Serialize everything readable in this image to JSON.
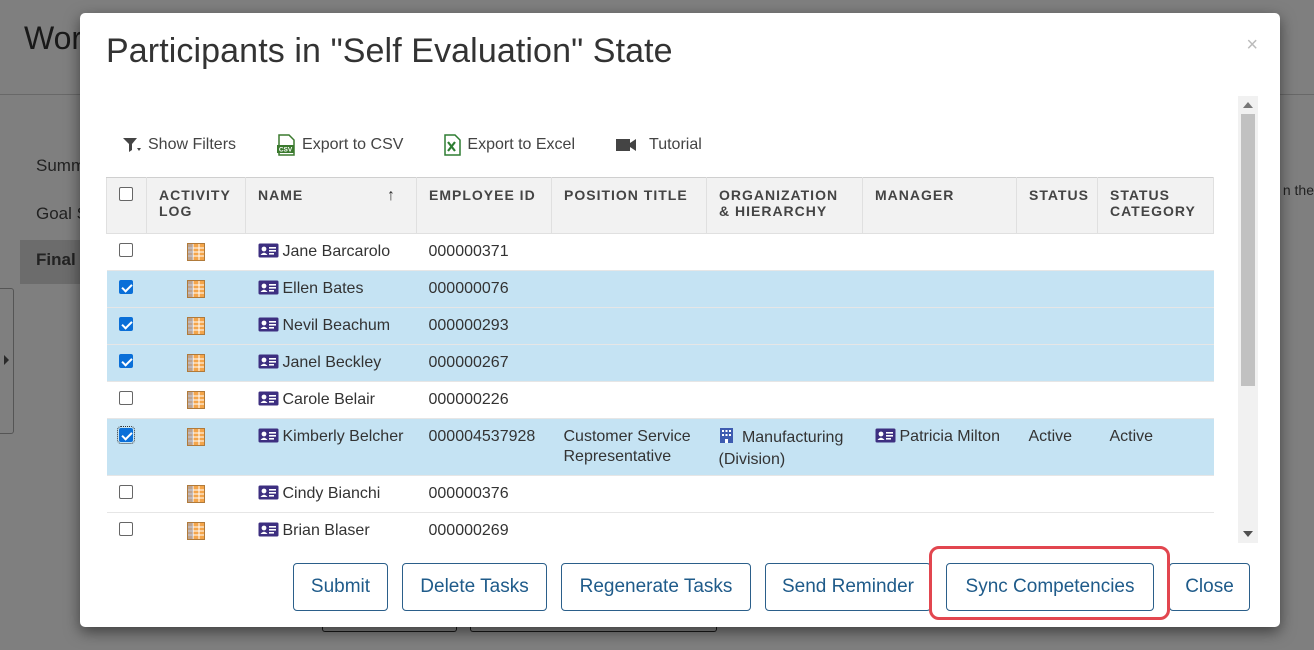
{
  "background": {
    "title": "Wor",
    "nav": [
      "Summ",
      "Goal S",
      "Final"
    ],
    "edge_text": "n the"
  },
  "modal": {
    "title": "Participants in \"Self Evaluation\" State",
    "close_glyph": "×"
  },
  "toolbar": {
    "show_filters": "Show Filters",
    "export_csv": "Export to CSV",
    "export_excel": "Export to Excel",
    "tutorial": "Tutorial"
  },
  "grid": {
    "columns": {
      "activity_log": "ACTIVITY LOG",
      "name": "NAME",
      "employee_id": "EMPLOYEE ID",
      "position_title": "POSITION TITLE",
      "organization": "ORGANIZATION & HIERARCHY",
      "manager": "MANAGER",
      "status": "STATUS",
      "status_category": "STATUS CATEGORY"
    },
    "sort_indicator": "↑",
    "rows": [
      {
        "name": "Jane Barcarolo",
        "employee_id": "000000371",
        "position": "",
        "organization": "",
        "manager": "",
        "status": "",
        "status_category": "",
        "selected": false
      },
      {
        "name": "Ellen Bates",
        "employee_id": "000000076",
        "position": "",
        "organization": "",
        "manager": "",
        "status": "",
        "status_category": "",
        "selected": true
      },
      {
        "name": "Nevil Beachum",
        "employee_id": "000000293",
        "position": "",
        "organization": "",
        "manager": "",
        "status": "",
        "status_category": "",
        "selected": true
      },
      {
        "name": "Janel Beckley",
        "employee_id": "000000267",
        "position": "",
        "organization": "",
        "manager": "",
        "status": "",
        "status_category": "",
        "selected": true
      },
      {
        "name": "Carole Belair",
        "employee_id": "000000226",
        "position": "",
        "organization": "",
        "manager": "",
        "status": "",
        "status_category": "",
        "selected": false
      },
      {
        "name": "Kimberly Belcher",
        "employee_id": "000004537928",
        "position": "Customer Service Representative",
        "organization": "Manufacturing (Division)",
        "manager": "Patricia Milton",
        "status": "Active",
        "status_category": "Active",
        "selected": true
      },
      {
        "name": "Cindy Bianchi",
        "employee_id": "000000376",
        "position": "",
        "organization": "",
        "manager": "",
        "status": "",
        "status_category": "",
        "selected": false
      },
      {
        "name": "Brian Blaser",
        "employee_id": "000000269",
        "position": "",
        "organization": "",
        "manager": "",
        "status": "",
        "status_category": "",
        "selected": false
      }
    ]
  },
  "footer": {
    "submit": "Submit",
    "delete_tasks": "Delete Tasks",
    "regenerate_tasks": "Regenerate Tasks",
    "send_reminder": "Send Reminder",
    "sync_competencies": "Sync Competencies",
    "close": "Close"
  },
  "colors": {
    "selected_row": "#c5e3f3",
    "button_border": "#2b5f8a",
    "highlight": "#e2464f",
    "checkbox": "#0a6fd8"
  }
}
